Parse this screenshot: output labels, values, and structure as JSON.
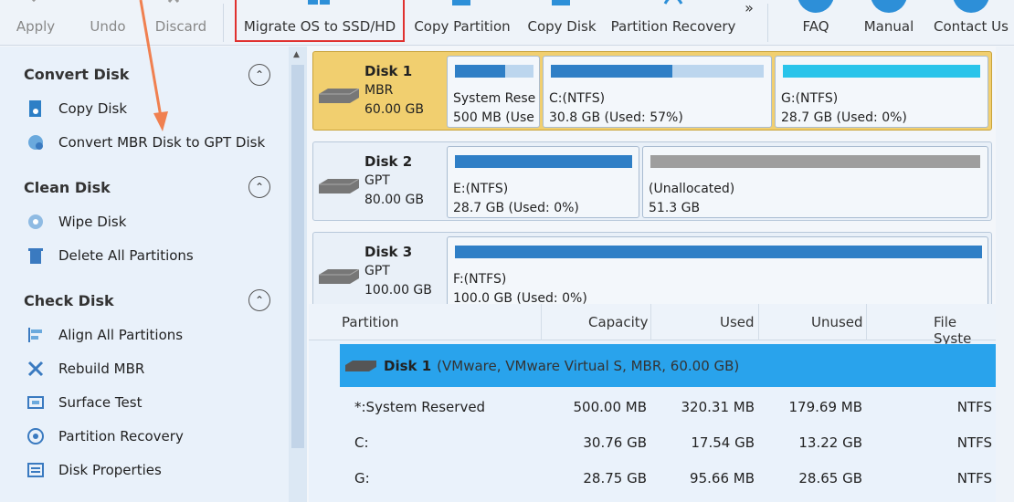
{
  "toolbar": {
    "items": [
      {
        "label": "Apply"
      },
      {
        "label": "Undo"
      },
      {
        "label": "Discard"
      },
      {
        "label": "Migrate OS to SSD/HD"
      },
      {
        "label": "Copy Partition"
      },
      {
        "label": "Copy Disk"
      },
      {
        "label": "Partition Recovery"
      },
      {
        "label": "FAQ"
      },
      {
        "label": "Manual"
      },
      {
        "label": "Contact Us"
      }
    ],
    "more_glyph": "»",
    "highlight_color": "#e0312f"
  },
  "sidebar": {
    "groups": [
      {
        "title": "Convert Disk",
        "items": [
          {
            "label": "Copy Disk",
            "icon": "copy-disk-icon"
          },
          {
            "label": "Convert MBR Disk to GPT Disk",
            "icon": "convert-disk-icon"
          }
        ]
      },
      {
        "title": "Clean Disk",
        "items": [
          {
            "label": "Wipe Disk",
            "icon": "wipe-disk-icon"
          },
          {
            "label": "Delete All Partitions",
            "icon": "trash-icon"
          }
        ]
      },
      {
        "title": "Check Disk",
        "items": [
          {
            "label": "Align All Partitions",
            "icon": "align-icon"
          },
          {
            "label": "Rebuild MBR",
            "icon": "wrench-icon"
          },
          {
            "label": "Surface Test",
            "icon": "surface-test-icon"
          },
          {
            "label": "Partition Recovery",
            "icon": "recovery-icon"
          },
          {
            "label": "Disk Properties",
            "icon": "properties-icon"
          }
        ]
      }
    ]
  },
  "disks": [
    {
      "name": "Disk 1",
      "type": "MBR",
      "size": "60.00 GB",
      "partitions": [
        {
          "name": "System Rese",
          "detail": "500 MB (Use",
          "used_fraction": 0.64
        },
        {
          "name": "C:(NTFS)",
          "detail": "30.8 GB (Used: 57%)",
          "used_fraction": 0.57
        },
        {
          "name": "G:(NTFS)",
          "detail": "28.7 GB (Used: 0%)",
          "used_fraction": 0.0
        }
      ]
    },
    {
      "name": "Disk 2",
      "type": "GPT",
      "size": "80.00 GB",
      "partitions": [
        {
          "name": "E:(NTFS)",
          "detail": "28.7 GB (Used: 0%)",
          "used_fraction": 0.0
        },
        {
          "name": "(Unallocated)",
          "detail": "51.3 GB",
          "used_fraction": 0.0
        }
      ]
    },
    {
      "name": "Disk 3",
      "type": "GPT",
      "size": "100.00 GB",
      "partitions": [
        {
          "name": "F:(NTFS)",
          "detail": "100.0 GB (Used: 0%)",
          "used_fraction": 0.0
        }
      ]
    }
  ],
  "table": {
    "headers": [
      "Partition",
      "Capacity",
      "Used",
      "Unused",
      "File Syste"
    ],
    "disk_header": {
      "name": "Disk 1",
      "detail": "(VMware, VMware Virtual S, MBR, 60.00 GB)"
    },
    "rows": [
      [
        "*:System Reserved",
        "500.00 MB",
        "320.31 MB",
        "179.69 MB",
        "NTFS"
      ],
      [
        "C:",
        "30.76 GB",
        "17.54 GB",
        "13.22 GB",
        "NTFS"
      ],
      [
        "G:",
        "28.75 GB",
        "95.66 MB",
        "28.65 GB",
        "NTFS"
      ]
    ]
  },
  "colors": {
    "selected_disk": "#f1cf6f",
    "disk_header": "#29a3ec",
    "used_bar": "#2f7fc6",
    "free_bar_cyan": "#29c4ea",
    "unallocated_bar": "#9e9e9e"
  }
}
